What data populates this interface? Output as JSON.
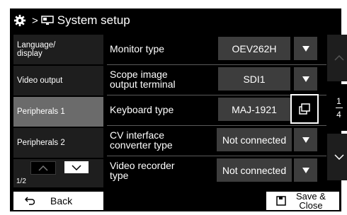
{
  "header": {
    "breadcrumb_sep": ">",
    "title": "System setup",
    "icons": [
      "gear-icon",
      "monitor-icon"
    ]
  },
  "sidebar": {
    "items": [
      {
        "label": "Language/\ndisplay",
        "selected": false
      },
      {
        "label": "Video output",
        "selected": false
      },
      {
        "label": "Peripherals 1",
        "selected": true
      },
      {
        "label": "Peripherals 2",
        "selected": false
      }
    ],
    "page": "1/2"
  },
  "settings": [
    {
      "label": "Monitor type",
      "value": "OEV262H",
      "control": "dropdown"
    },
    {
      "label": "Scope image\noutput terminal",
      "value": "SDI1",
      "control": "dropdown"
    },
    {
      "label": "Keyboard type",
      "value": "MAJ-1921",
      "control": "popup"
    },
    {
      "label": "CV interface\nconverter type",
      "value": "Not connected",
      "control": "dropdown"
    },
    {
      "label": "Video recorder\ntype",
      "value": "Not connected",
      "control": "dropdown"
    }
  ],
  "scroll": {
    "current": "1",
    "total": "4"
  },
  "footer": {
    "back_label": "Back",
    "save_label": "Save &\nClose"
  },
  "colors": {
    "background": "#000000",
    "selected": "#6b6b6b",
    "field": "#3d3d3d"
  }
}
